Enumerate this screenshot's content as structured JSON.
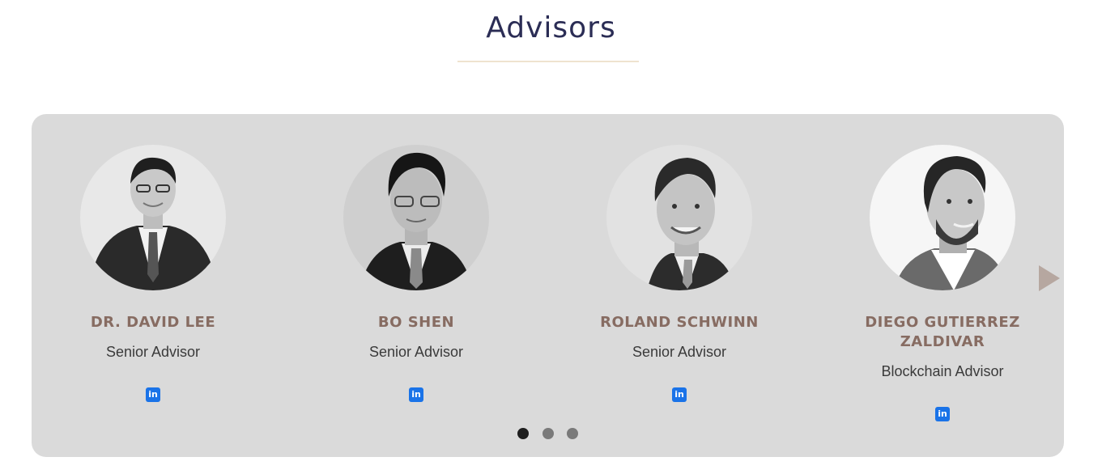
{
  "section": {
    "title": "Advisors"
  },
  "advisors": [
    {
      "name": "DR. DAVID LEE",
      "role": "Senior Advisor",
      "linkedin_icon": "in"
    },
    {
      "name": "BO SHEN",
      "role": "Senior Advisor",
      "linkedin_icon": "in"
    },
    {
      "name": "ROLAND SCHWINN",
      "role": "Senior Advisor",
      "linkedin_icon": "in"
    },
    {
      "name": "DIEGO GUTIERREZ\nZALDIVAR",
      "role": "Blockchain Advisor",
      "linkedin_icon": "in"
    }
  ],
  "carousel": {
    "page_count": 3,
    "active_page": 1,
    "next_icon": "triangle-right-icon"
  },
  "colors": {
    "title": "#2b2d55",
    "name": "#876c62",
    "panel": "#dadada",
    "linkedin": "#1a73e8"
  }
}
